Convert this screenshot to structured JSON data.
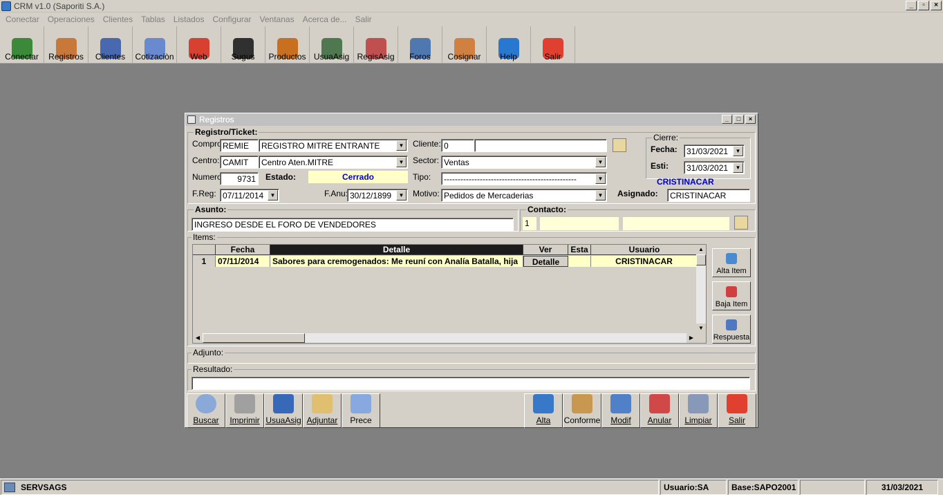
{
  "app": {
    "title": "CRM v1.0 (Saporiti S.A.)"
  },
  "menu": [
    "Conectar",
    "Operaciones",
    "Clientes",
    "Tablas",
    "Listados",
    "Configurar",
    "Ventanas",
    "Acerca de...",
    "Salir"
  ],
  "toolbar": [
    {
      "label": "Conectar",
      "icon": "connect-icon",
      "color": "#3a8a3a"
    },
    {
      "label": "Registros",
      "icon": "headset-user-icon",
      "color": "#c87838"
    },
    {
      "label": "Clientes",
      "icon": "user-icon",
      "color": "#4868b0"
    },
    {
      "label": "Cotizaciòn",
      "icon": "checklist-icon",
      "color": "#6a8ad0"
    },
    {
      "label": "Web",
      "icon": "calendar-icon",
      "color": "#d84030"
    },
    {
      "label": "Sugus",
      "icon": "agent-icon",
      "color": "#303030"
    },
    {
      "label": "Productos",
      "icon": "briefcase-icon",
      "color": "#c87020"
    },
    {
      "label": "UsuaAsig",
      "icon": "users-icon",
      "color": "#507850"
    },
    {
      "label": "RegisAsig",
      "icon": "document-check-icon",
      "color": "#c05050"
    },
    {
      "label": "Foros",
      "icon": "forum-icon",
      "color": "#5078b0"
    },
    {
      "label": "Cosignar",
      "icon": "operator-icon",
      "color": "#d08040"
    },
    {
      "label": "Help",
      "icon": "help-icon",
      "color": "#2878d0"
    },
    {
      "label": "Salir",
      "icon": "power-icon",
      "color": "#e04030"
    }
  ],
  "window": {
    "title": "Registros",
    "registro": {
      "group_label": "Registro/Ticket:",
      "compro_label": "Compro:",
      "compro_code": "REMIE",
      "compro_desc": "REGISTRO MITRE ENTRANTE",
      "centro_label": "Centro:",
      "centro_code": "CAMIT",
      "centro_desc": "Centro Aten.MITRE",
      "numero_label": "Numero:",
      "numero": "9731",
      "estado_label": "Estado:",
      "estado": "Cerrado",
      "freg_label": "F.Reg:",
      "freg": "07/11/2014",
      "fanu_label": "F.Anu:",
      "fanu": "30/12/1899",
      "cliente_label": "Cliente:",
      "cliente_code": "0",
      "cliente_name": "",
      "sector_label": "Sector:",
      "sector": "Ventas",
      "tipo_label": "Tipo:",
      "tipo": "------------------------------------------------",
      "motivo_label": "Motivo:",
      "motivo": "Pedidos de Mercaderias"
    },
    "cierre": {
      "group_label": "Cierre:",
      "fecha_label": "Fecha:",
      "fecha": "31/03/2021",
      "esti_label": "Esti:",
      "esti": "31/03/2021",
      "user": "CRISTINACAR",
      "asignado_label": "Asignado:",
      "asignado": "CRISTINACAR"
    },
    "asunto": {
      "label": "Asunto:",
      "value": "INGRESO DESDE EL FORO DE VENDEDORES"
    },
    "contacto": {
      "label": "Contacto:",
      "num": "1",
      "v1": "",
      "v2": ""
    },
    "items": {
      "label": "Items:",
      "headers": [
        "",
        "Fecha",
        "Detalle",
        "Ver",
        "Esta",
        "Usuario"
      ],
      "rows": [
        {
          "n": "1",
          "fecha": "07/11/2014",
          "detalle": "Sabores para cremogenados: Me reuní con Analía Batalla, hija",
          "ver": "Detalle",
          "esta": "",
          "usuario": "CRISTINACAR"
        }
      ]
    },
    "side_buttons": [
      {
        "label": "Alta Item",
        "icon": "add-item-icon"
      },
      {
        "label": "Baja Item",
        "icon": "remove-item-icon"
      },
      {
        "label": "Respuesta",
        "icon": "reply-icon"
      }
    ],
    "adjunto_label": "Adjunto:",
    "resultado_label": "Resultado:",
    "resultado": "",
    "bottom_left": [
      {
        "label": "Buscar",
        "icon": "magnifier-icon"
      },
      {
        "label": "Imprimir",
        "icon": "printer-icon"
      },
      {
        "label": "UsuaAsig",
        "icon": "user-assign-icon"
      },
      {
        "label": "Adjuntar",
        "icon": "paperclip-icon"
      },
      {
        "label": "Prece",
        "icon": "chat-icon"
      }
    ],
    "bottom_right": [
      {
        "label": "Alta",
        "icon": "db-add-icon"
      },
      {
        "label": "Conforme",
        "icon": "handshake-icon"
      },
      {
        "label": "Modif",
        "icon": "edit-icon"
      },
      {
        "label": "Anular",
        "icon": "db-cancel-icon"
      },
      {
        "label": "Limpiar",
        "icon": "clean-icon"
      },
      {
        "label": "Salir",
        "icon": "power-icon"
      }
    ]
  },
  "statusbar": {
    "server": "SERVSAGS",
    "usuario": "Usuario:SA",
    "base": "Base:SAPO2001",
    "extra": "",
    "fecha": "31/03/2021"
  }
}
